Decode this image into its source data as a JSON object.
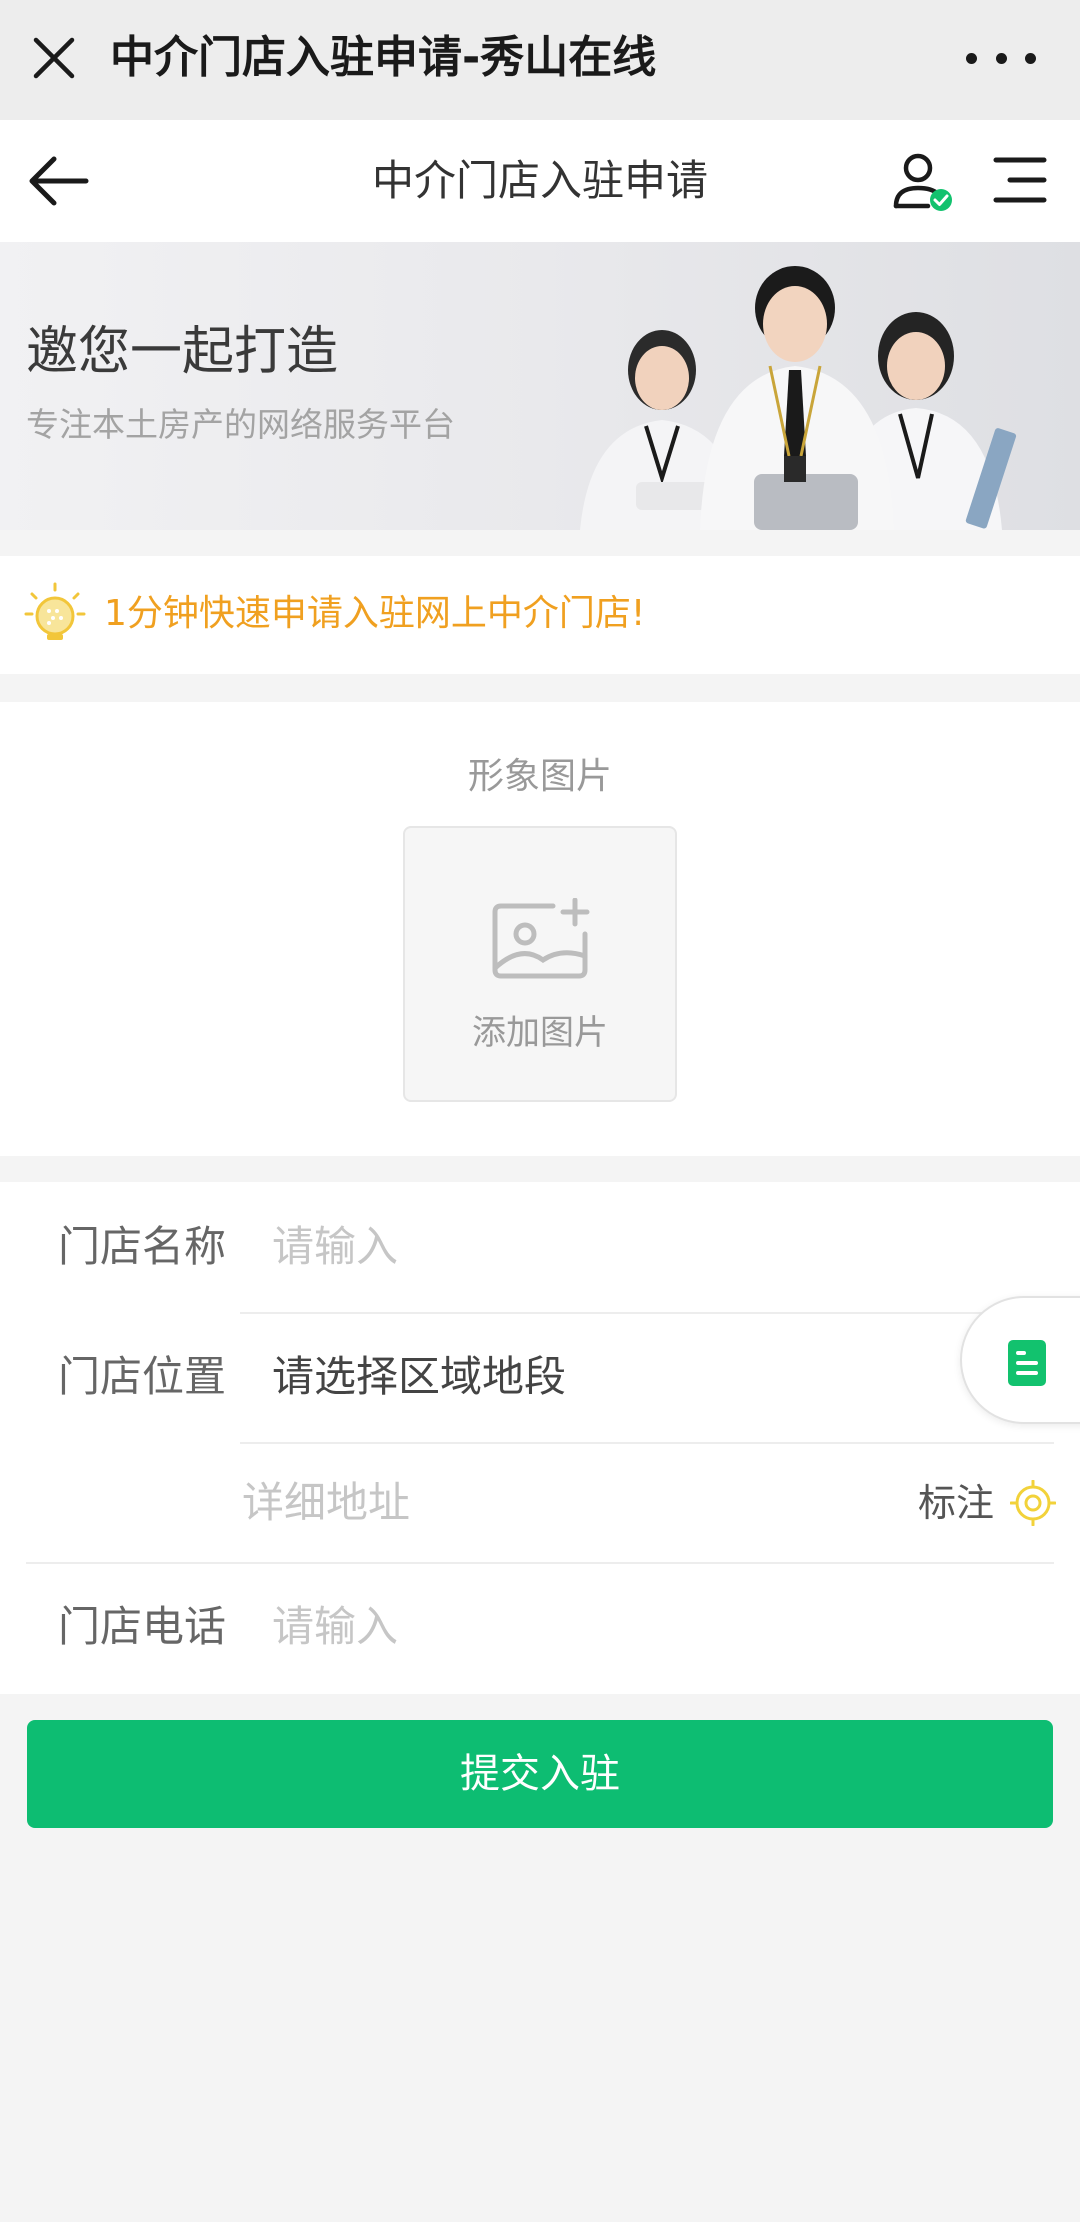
{
  "webview": {
    "title": "中介门店入驻申请-秀山在线"
  },
  "nav": {
    "title": "中介门店入驻申请"
  },
  "banner": {
    "heading": "邀您一起打造",
    "subheading": "专注本土房产的网络服务平台"
  },
  "tip": {
    "text": "1分钟快速申请入驻网上中介门店!"
  },
  "image_upload": {
    "label": "形象图片",
    "add_text": "添加图片"
  },
  "form": {
    "store_name": {
      "label": "门店名称",
      "placeholder": "请输入"
    },
    "store_location": {
      "label": "门店位置",
      "value": "请选择区域地段"
    },
    "address": {
      "placeholder": "详细地址",
      "mark_label": "标注"
    },
    "store_phone": {
      "label": "门店电话",
      "placeholder": "请输入"
    }
  },
  "submit_label": "提交入驻",
  "colors": {
    "accent_green": "#0dbd72",
    "tip_orange": "#f0a020",
    "mark_yellow": "#f2d23a"
  },
  "icons": [
    "close-icon",
    "more-icon",
    "back-arrow-icon",
    "user-verified-icon",
    "menu-icon",
    "lightbulb-icon",
    "add-image-icon",
    "location-target-icon",
    "document-icon"
  ]
}
